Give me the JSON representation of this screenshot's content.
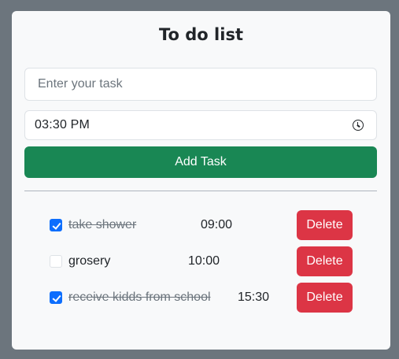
{
  "app": {
    "title": "To do list"
  },
  "form": {
    "task_placeholder": "Enter your task",
    "time_value": "03:30 PM",
    "add_label": "Add Task"
  },
  "tasks": [
    {
      "name": "take shower",
      "time": "09:00",
      "done": true,
      "delete_label": "Delete"
    },
    {
      "name": "grosery",
      "time": "10:00",
      "done": false,
      "delete_label": "Delete"
    },
    {
      "name": "receive kidds from school",
      "time": "15:30",
      "done": true,
      "delete_label": "Delete"
    }
  ],
  "colors": {
    "background": "#6c757d",
    "card": "#f8f9fa",
    "add_button": "#198754",
    "delete_button": "#dc3545",
    "checkbox_checked": "#0d6efd"
  }
}
